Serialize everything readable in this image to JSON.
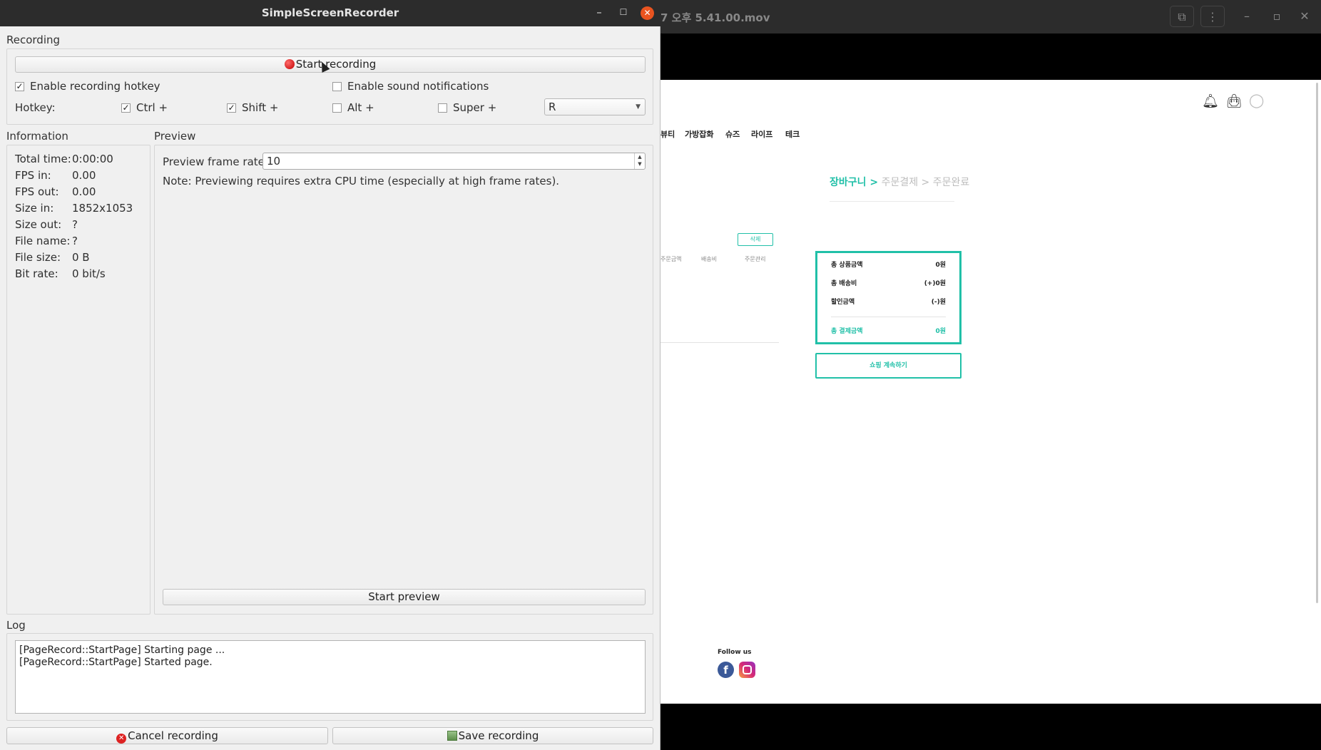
{
  "player": {
    "title": "7 오후 5.41.00.mov",
    "controls": [
      "picture-in-picture-icon",
      "more-icon",
      "minimize-icon",
      "restore-icon",
      "close-icon"
    ]
  },
  "webpage": {
    "nav": [
      "뷰티",
      "가방잡화",
      "슈즈",
      "라이프",
      "테크"
    ],
    "breadcrumb": {
      "current": "장바구니 >",
      "rest": " 주문결제 > 주문완료"
    },
    "delete_button": "삭제",
    "table_headers": [
      "주문금액",
      "배송비",
      "주문관리"
    ],
    "summary": [
      {
        "label": "총 상품금액",
        "value": "0원"
      },
      {
        "label": "총 배송비",
        "value": "(+)0원"
      },
      {
        "label": "할인금액",
        "value": "(-)원"
      }
    ],
    "total": {
      "label": "총 결제금액",
      "value": "0원"
    },
    "continue_shopping": "쇼핑 계속하기",
    "follow_us": "Follow us",
    "accent_color": "#21c0a8"
  },
  "ssr": {
    "title": "SimpleScreenRecorder",
    "recording": {
      "section": "Recording",
      "start_button": "Start recording",
      "enable_hotkey": "Enable recording hotkey",
      "enable_hotkey_checked": true,
      "enable_sound": "Enable sound notifications",
      "enable_sound_checked": false,
      "hotkey_label": "Hotkey:",
      "ctrl": "Ctrl +",
      "ctrl_checked": true,
      "shift": "Shift +",
      "shift_checked": true,
      "alt": "Alt +",
      "alt_checked": false,
      "super": "Super +",
      "super_checked": false,
      "key": "R"
    },
    "information": {
      "section": "Information",
      "rows": [
        {
          "k": "Total time:",
          "v": "0:00:00"
        },
        {
          "k": "FPS in:",
          "v": "0.00"
        },
        {
          "k": "FPS out:",
          "v": "0.00"
        },
        {
          "k": "Size in:",
          "v": "1852x1053"
        },
        {
          "k": "Size out:",
          "v": "?"
        },
        {
          "k": "File name:",
          "v": "?"
        },
        {
          "k": "File size:",
          "v": "0 B"
        },
        {
          "k": "Bit rate:",
          "v": "0 bit/s"
        }
      ]
    },
    "preview": {
      "section": "Preview",
      "frame_rate_label": "Preview frame rate:",
      "frame_rate": "10",
      "note": "Note: Previewing requires extra CPU time (especially at high frame rates).",
      "start_button": "Start preview"
    },
    "log": {
      "section": "Log",
      "lines": [
        "[PageRecord::StartPage] Starting page ...",
        "[PageRecord::StartPage] Started page."
      ]
    },
    "cancel_button": "Cancel recording",
    "save_button": "Save recording"
  }
}
